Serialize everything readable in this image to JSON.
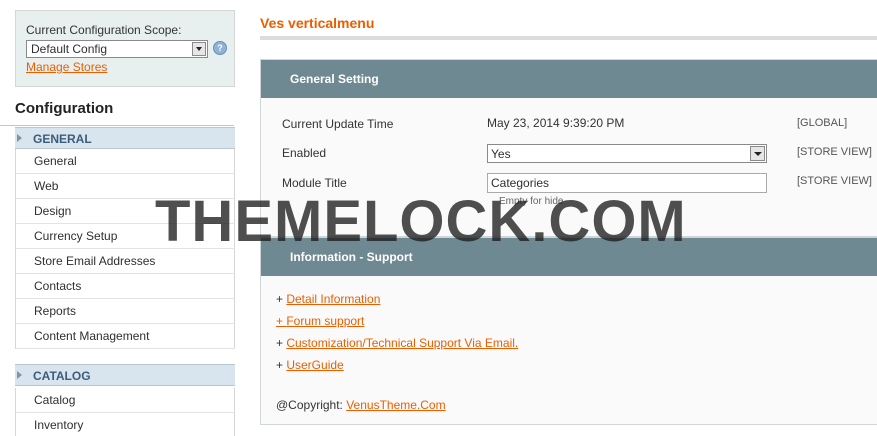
{
  "sidebar": {
    "scope_label": "Current Configuration Scope:",
    "scope_value": "Default Config",
    "manage_stores": "Manage Stores",
    "config_title": "Configuration",
    "sections": [
      {
        "label": "GENERAL",
        "items": [
          "General",
          "Web",
          "Design",
          "Currency Setup",
          "Store Email Addresses",
          "Contacts",
          "Reports",
          "Content Management"
        ]
      },
      {
        "label": "CATALOG",
        "items": [
          "Catalog",
          "Inventory"
        ]
      }
    ]
  },
  "main": {
    "title": "Ves verticalmenu",
    "general": {
      "heading": "General Setting",
      "rows": [
        {
          "label": "Current Update Time",
          "value": "May 23, 2014 9:39:20 PM",
          "scope": "[GLOBAL]"
        },
        {
          "label": "Enabled",
          "value": "Yes",
          "scope": "[STORE VIEW]"
        },
        {
          "label": "Module Title",
          "value": "Categories",
          "scope": "[STORE VIEW]",
          "note": "Empty for hide"
        }
      ]
    },
    "support": {
      "heading": "Information - Support",
      "links": [
        "Detail Information",
        "Forum support",
        "Customization/Technical Support Via Email.",
        "UserGuide"
      ],
      "link_prefix": "+ ",
      "copyright_label": "@Copyright: ",
      "copyright_link": "VenusTheme.Com"
    }
  },
  "watermark": "THEMELOCK.COM",
  "colors": {
    "accent": "#eb5e00",
    "panel_header": "#6f8992",
    "section_bg": "#d9e5ee"
  }
}
